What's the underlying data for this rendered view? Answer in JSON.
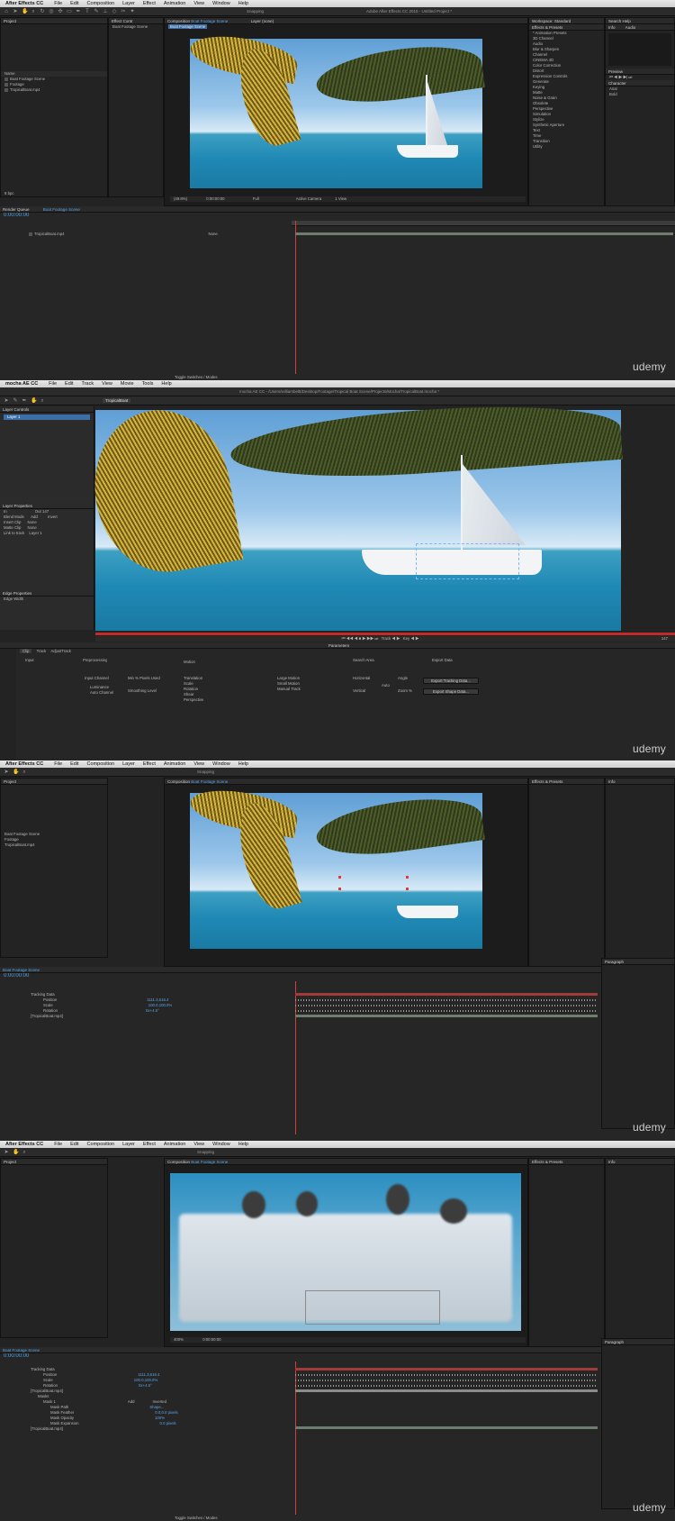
{
  "frames": [
    {
      "app": "After Effects CC",
      "menus": [
        "File",
        "Edit",
        "Composition",
        "Layer",
        "Effect",
        "Animation",
        "View",
        "Window",
        "Help"
      ],
      "window_title": "Adobe After Effects CC 2015 - Untitled Project *",
      "toolbar_label": "Snapping",
      "project_tab": "Project",
      "effect_tab": "Effect Contr",
      "comp_tab_prefix": "Composition",
      "comp_tab_name": "Boat Footage Scene",
      "layer_tab": "Layer (none)",
      "comp_breadcrumb": "Boat Footage Scene",
      "project_items": [
        "Boat Footage Scene",
        "Footage",
        "TropicalBoat.mp4"
      ],
      "workspace": "Workspace: Standard",
      "search_help": "Search Help",
      "info_tab": "Info",
      "audio_tab": "Audio",
      "effects_tab": "Effects & Presets",
      "effects_items": [
        "* Animation Presets",
        "3D Channel",
        "Audio",
        "Blur & Sharpen",
        "Channel",
        "CINEMA 4D",
        "Color Correction",
        "Distort",
        "Expression Controls",
        "Generate",
        "Keying",
        "Matte",
        "Noise & Grain",
        "Obsolete",
        "Perspective",
        "Simulation",
        "Stylize",
        "Synthetic Aperture",
        "Text",
        "Time",
        "Transition",
        "Utility"
      ],
      "preview_tab": "Preview",
      "character_tab": "Character",
      "font": "Arial",
      "font_style": "Bold",
      "viewer_zoom": "(49.8%)",
      "viewer_time": "0:00:00:00",
      "viewer_res": "Full",
      "viewer_camera": "Active Camera",
      "viewer_views": "1 View",
      "render_queue": "Render Queue",
      "timeline_tab": "Boat Footage Scene",
      "timecode": "0:00:00:00",
      "layer_rows": [
        "TropicalBoat.mp4"
      ],
      "parent_label": "None",
      "toggle_label": "Toggle Switches / Modes",
      "bpc": "8 bpc",
      "watermark": "udemy"
    },
    {
      "app": "mocha AE CC",
      "menus": [
        "File",
        "Edit",
        "Track",
        "View",
        "Movie",
        "Tools",
        "Help"
      ],
      "window_title": "mocha AE CC - /Users/williambeltt/Desktop/Footage/Tropical Boat Scene/Projects/Mocha/TropicalBoat.mocha *",
      "layer_controls": "Layer Controls",
      "layer_name": "Layer 1",
      "clip_selector": "TropicalBoat",
      "layer_properties": "Layer Properties",
      "in_label": "In",
      "out_label": "Out",
      "out_value": "147",
      "blend_mode": "Blend Mode",
      "blend_value": "Add",
      "invert": "Invert",
      "insert_clip": "Insert Clip",
      "matte_clip": "Matte Clip",
      "none": "None",
      "link_track": "Link to track",
      "link_value": "Layer 1",
      "edge_props": "Edge Properties",
      "edge_width": "Edge Width",
      "parameters": "Parameters",
      "param_tabs": [
        "Clip",
        "Track",
        "AdjustTrack"
      ],
      "input": "Input",
      "preprocessing": "Preprocessing",
      "motion": "Motion",
      "search_area": "Search Area",
      "export_data": "Export Data",
      "input_channel": "Input Channel",
      "luminance": "Luminance",
      "auto_channel": "Auto Channel",
      "min_pixels": "Min % Pixels Used",
      "smoothing": "Smoothing Level",
      "motion_items": [
        "Translation",
        "Scale",
        "Rotation",
        "Shear",
        "Perspective"
      ],
      "motion_types": [
        "Large Motion",
        "Small Motion",
        "Manual Track"
      ],
      "horizontal": "Horizontal",
      "vertical": "Vertical",
      "angle": "Angle",
      "zoom": "Zoom %",
      "auto": "Auto",
      "export_tracking": "Export Tracking Data...",
      "export_shape": "Export Shape Data...",
      "side_tabs": [
        "Dope Sheet",
        "Parameters"
      ],
      "frame_end": "147",
      "watermark": "udemy"
    },
    {
      "app": "After Effects CC",
      "layer_rows": [
        "Tracking Data",
        "Position",
        "Scale",
        "Rotation",
        "[TropicalBoat.mp4]"
      ],
      "values": [
        "1111.3,616.4",
        "100.0,100.0%",
        "0x+4.5°"
      ],
      "paragraph_tab": "Paragraph",
      "watermark": "udemy"
    },
    {
      "app": "After Effects CC",
      "layer_rows": [
        "Tracking Data",
        "Position",
        "Scale",
        "Rotation",
        "[TropicalBoat.mp4]",
        "Masks",
        "Mask 1",
        "Mask Path",
        "Mask Feather",
        "Mask Opacity",
        "Mask Expansion",
        "[TropicalBoat.mp4]"
      ],
      "mask_mode": "Add",
      "mask_inverted": "Inverted",
      "values": [
        "1111.3,616.4",
        "100.0,100.0%",
        "0x+4.5°",
        "Shape...",
        "0.0,0.0 pixels",
        "100%",
        "0.0 pixels"
      ],
      "viewer_zoom": "400%",
      "watermark": "udemy"
    }
  ],
  "colors": {
    "accent": "#58a6e8",
    "playhead": "#d63c3c",
    "track_bar": "#a23a3a"
  }
}
